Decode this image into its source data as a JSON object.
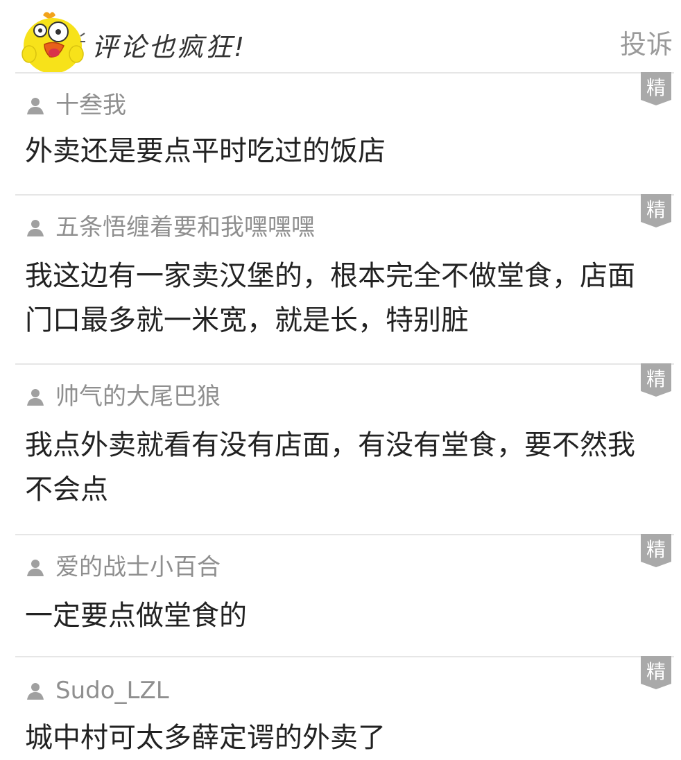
{
  "header": {
    "title": "评论也疯狂!",
    "report_label": "投诉"
  },
  "badge_label": "精",
  "comments": [
    {
      "author": "十叁我",
      "text": "外卖还是要点平时吃过的饭店"
    },
    {
      "author": "五条悟缠着要和我嘿嘿嘿",
      "text": "我这边有一家卖汉堡的，根本完全不做堂食，店面门口最多就一米宽，就是长，特别脏"
    },
    {
      "author": "帅气的大尾巴狼",
      "text": "我点外卖就看有没有店面，有没有堂食，要不然我不会点"
    },
    {
      "author": "爱的战士小百合",
      "text": "一定要点做堂食的"
    },
    {
      "author": "Sudo_LZL",
      "text": "城中村可太多薛定谔的外卖了"
    }
  ],
  "colors": {
    "mascot_yellow": "#f7e21a",
    "badge_gray": "#a9a9a9",
    "text_dark": "#222222",
    "text_gray": "#8f8f8f"
  }
}
